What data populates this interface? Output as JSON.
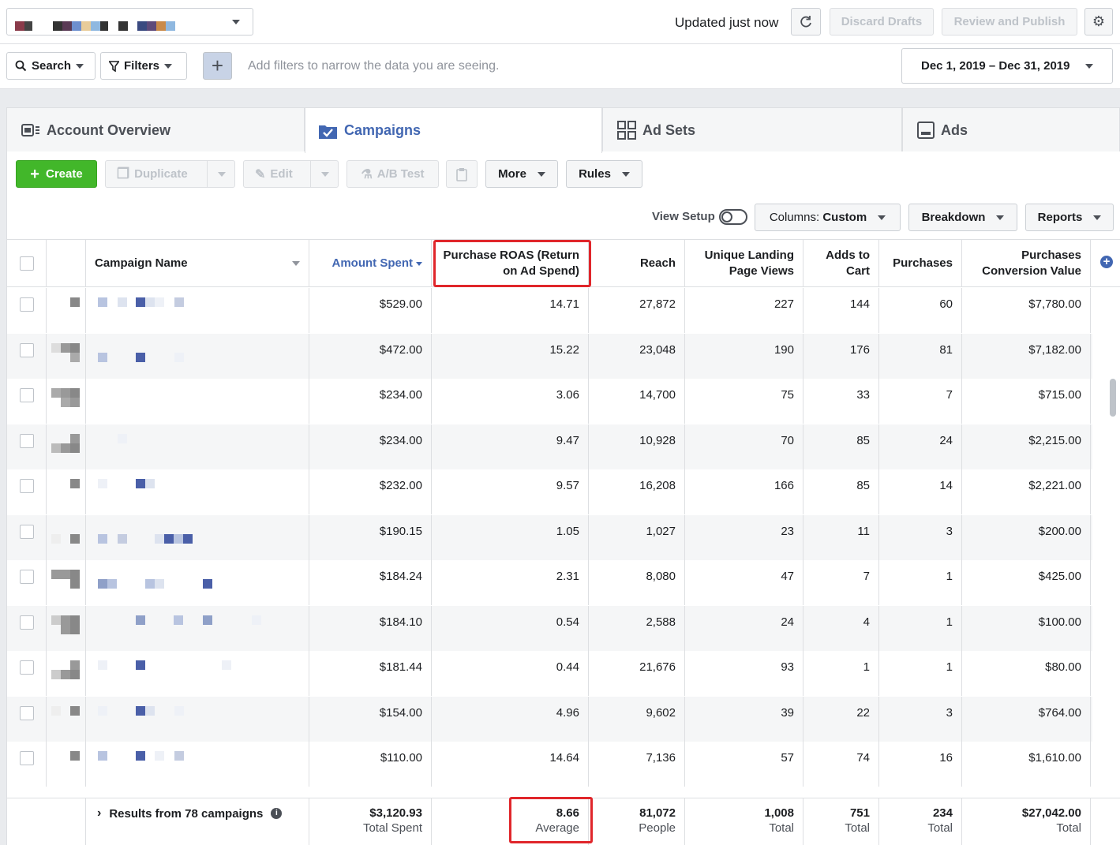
{
  "topbar": {
    "updated": "Updated just now",
    "discard": "Discard Drafts",
    "review": "Review and Publish"
  },
  "filterbar": {
    "search": "Search",
    "filters": "Filters",
    "hint": "Add filters to narrow the data you are seeing.",
    "date_range": "Dec 1, 2019 – Dec 31, 2019"
  },
  "tabs": [
    {
      "label": "Account Overview",
      "icon": "account-overview-icon"
    },
    {
      "label": "Campaigns",
      "icon": "folder-check-icon"
    },
    {
      "label": "Ad Sets",
      "icon": "grid-icon"
    },
    {
      "label": "Ads",
      "icon": "ad-icon"
    }
  ],
  "actions": {
    "create": "Create",
    "duplicate": "Duplicate",
    "edit": "Edit",
    "ab_test": "A/B Test",
    "more": "More",
    "rules": "Rules",
    "view_setup": "View Setup",
    "columns_prefix": "Columns:",
    "columns_value": "Custom",
    "breakdown": "Breakdown",
    "reports": "Reports"
  },
  "columns": {
    "name": "Campaign Name",
    "amount": "Amount Spent",
    "roas_1": "Purchase ROAS (Return",
    "roas_2": "on Ad Spend)",
    "reach": "Reach",
    "ulpv_1": "Unique Landing",
    "ulpv_2": "Page Views",
    "atc_1": "Adds to",
    "atc_2": "Cart",
    "purchases": "Purchases",
    "pcv_1": "Purchases",
    "pcv_2": "Conversion Value"
  },
  "rows": [
    {
      "amount": "$529.00",
      "roas": "14.71",
      "reach": "27,872",
      "ulpv": "227",
      "atc": "144",
      "purchases": "60",
      "pcv": "$7,780.00"
    },
    {
      "amount": "$472.00",
      "roas": "15.22",
      "reach": "23,048",
      "ulpv": "190",
      "atc": "176",
      "purchases": "81",
      "pcv": "$7,182.00"
    },
    {
      "amount": "$234.00",
      "roas": "3.06",
      "reach": "14,700",
      "ulpv": "75",
      "atc": "33",
      "purchases": "7",
      "pcv": "$715.00"
    },
    {
      "amount": "$234.00",
      "roas": "9.47",
      "reach": "10,928",
      "ulpv": "70",
      "atc": "85",
      "purchases": "24",
      "pcv": "$2,215.00"
    },
    {
      "amount": "$232.00",
      "roas": "9.57",
      "reach": "16,208",
      "ulpv": "166",
      "atc": "85",
      "purchases": "14",
      "pcv": "$2,221.00"
    },
    {
      "amount": "$190.15",
      "roas": "1.05",
      "reach": "1,027",
      "ulpv": "23",
      "atc": "11",
      "purchases": "3",
      "pcv": "$200.00"
    },
    {
      "amount": "$184.24",
      "roas": "2.31",
      "reach": "8,080",
      "ulpv": "47",
      "atc": "7",
      "purchases": "1",
      "pcv": "$425.00"
    },
    {
      "amount": "$184.10",
      "roas": "0.54",
      "reach": "2,588",
      "ulpv": "24",
      "atc": "4",
      "purchases": "1",
      "pcv": "$100.00"
    },
    {
      "amount": "$181.44",
      "roas": "0.44",
      "reach": "21,676",
      "ulpv": "93",
      "atc": "1",
      "purchases": "1",
      "pcv": "$80.00"
    },
    {
      "amount": "$154.00",
      "roas": "4.96",
      "reach": "9,602",
      "ulpv": "39",
      "atc": "22",
      "purchases": "3",
      "pcv": "$764.00"
    },
    {
      "amount": "$110.00",
      "roas": "14.64",
      "reach": "7,136",
      "ulpv": "57",
      "atc": "74",
      "purchases": "16",
      "pcv": "$1,610.00"
    }
  ],
  "footer": {
    "results": "Results from 78 campaigns",
    "amount": "$3,120.93",
    "amount_l": "Total Spent",
    "roas": "8.66",
    "roas_l": "Average",
    "reach": "81,072",
    "reach_l": "People",
    "ulpv": "1,008",
    "ulpv_l": "Total",
    "atc": "751",
    "atc_l": "Total",
    "purchases": "234",
    "purchases_l": "Total",
    "pcv": "$27,042.00",
    "pcv_l": "Total"
  },
  "colors": {
    "accent": "#4267b2",
    "create_green": "#42b72a",
    "highlight_red": "#e0262b"
  }
}
